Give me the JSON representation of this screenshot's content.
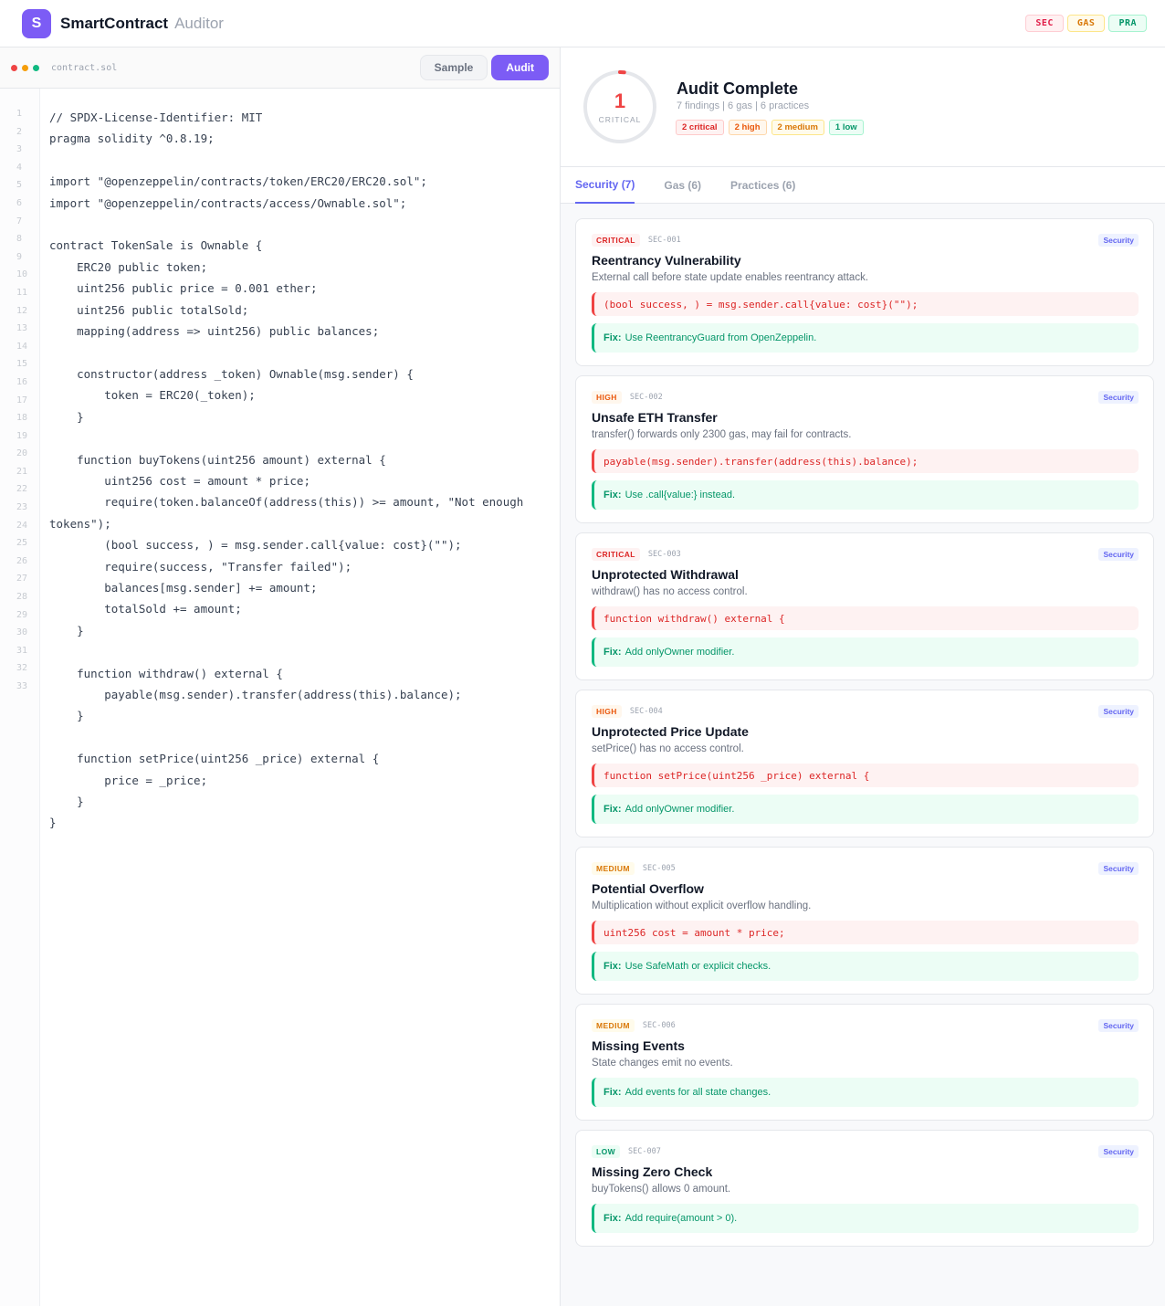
{
  "header": {
    "logo_letter": "S",
    "brand": "SmartContract",
    "brand_sub": "Auditor",
    "badges": [
      "SEC",
      "GAS",
      "PRA"
    ]
  },
  "editor": {
    "filename": "contract.sol",
    "sample_label": "Sample",
    "audit_label": "Audit",
    "line_numbers": [
      "1",
      "2",
      "3",
      "4",
      "5",
      "6",
      "7",
      "8",
      "9",
      "10",
      "11",
      "12",
      "13",
      "14",
      "15",
      "16",
      "17",
      "18",
      "19",
      "20",
      "21",
      "22",
      "23",
      "24",
      "25",
      "26",
      "27",
      "28",
      "29",
      "30",
      "31",
      "32",
      "33"
    ],
    "code": "// SPDX-License-Identifier: MIT\npragma solidity ^0.8.19;\n\nimport \"@openzeppelin/contracts/token/ERC20/ERC20.sol\";\nimport \"@openzeppelin/contracts/access/Ownable.sol\";\n\ncontract TokenSale is Ownable {\n    ERC20 public token;\n    uint256 public price = 0.001 ether;\n    uint256 public totalSold;\n    mapping(address => uint256) public balances;\n\n    constructor(address _token) Ownable(msg.sender) {\n        token = ERC20(_token);\n    }\n\n    function buyTokens(uint256 amount) external {\n        uint256 cost = amount * price;\n        require(token.balanceOf(address(this)) >= amount, \"Not enough tokens\");\n        (bool success, ) = msg.sender.call{value: cost}(\"\");\n        require(success, \"Transfer failed\");\n        balances[msg.sender] += amount;\n        totalSold += amount;\n    }\n\n    function withdraw() external {\n        payable(msg.sender).transfer(address(this).balance);\n    }\n\n    function setPrice(uint256 _price) external {\n        price = _price;\n    }\n}"
  },
  "summary": {
    "score": "1",
    "score_label": "CRITICAL",
    "score_fraction": 0.02,
    "title": "Audit Complete",
    "subtitle": "7 findings | 6 gas | 6 practices",
    "badges": [
      "2 critical",
      "2 high",
      "2 medium",
      "1 low"
    ]
  },
  "tabs": [
    "Security (7)",
    "Gas (6)",
    "Practices (6)"
  ],
  "fix_label": "Fix:",
  "findings": [
    {
      "severity": "CRITICAL",
      "id": "SEC-001",
      "category": "Security",
      "title": "Reentrancy Vulnerability",
      "desc": "External call before state update enables reentrancy attack.",
      "code": "(bool success, ) = msg.sender.call{value: cost}(\"\");",
      "fix": "Use ReentrancyGuard from OpenZeppelin."
    },
    {
      "severity": "HIGH",
      "id": "SEC-002",
      "category": "Security",
      "title": "Unsafe ETH Transfer",
      "desc": "transfer() forwards only 2300 gas, may fail for contracts.",
      "code": "payable(msg.sender).transfer(address(this).balance);",
      "fix": "Use .call{value:} instead."
    },
    {
      "severity": "CRITICAL",
      "id": "SEC-003",
      "category": "Security",
      "title": "Unprotected Withdrawal",
      "desc": "withdraw() has no access control.",
      "code": "function withdraw() external {",
      "fix": "Add onlyOwner modifier."
    },
    {
      "severity": "HIGH",
      "id": "SEC-004",
      "category": "Security",
      "title": "Unprotected Price Update",
      "desc": "setPrice() has no access control.",
      "code": "function setPrice(uint256 _price) external {",
      "fix": "Add onlyOwner modifier."
    },
    {
      "severity": "MEDIUM",
      "id": "SEC-005",
      "category": "Security",
      "title": "Potential Overflow",
      "desc": "Multiplication without explicit overflow handling.",
      "code": "uint256 cost = amount * price;",
      "fix": "Use SafeMath or explicit checks."
    },
    {
      "severity": "MEDIUM",
      "id": "SEC-006",
      "category": "Security",
      "title": "Missing Events",
      "desc": "State changes emit no events.",
      "code": "",
      "fix": "Add events for all state changes."
    },
    {
      "severity": "LOW",
      "id": "SEC-007",
      "category": "Security",
      "title": "Missing Zero Check",
      "desc": "buyTokens() allows 0 amount.",
      "code": "",
      "fix": "Add require(amount > 0)."
    }
  ]
}
